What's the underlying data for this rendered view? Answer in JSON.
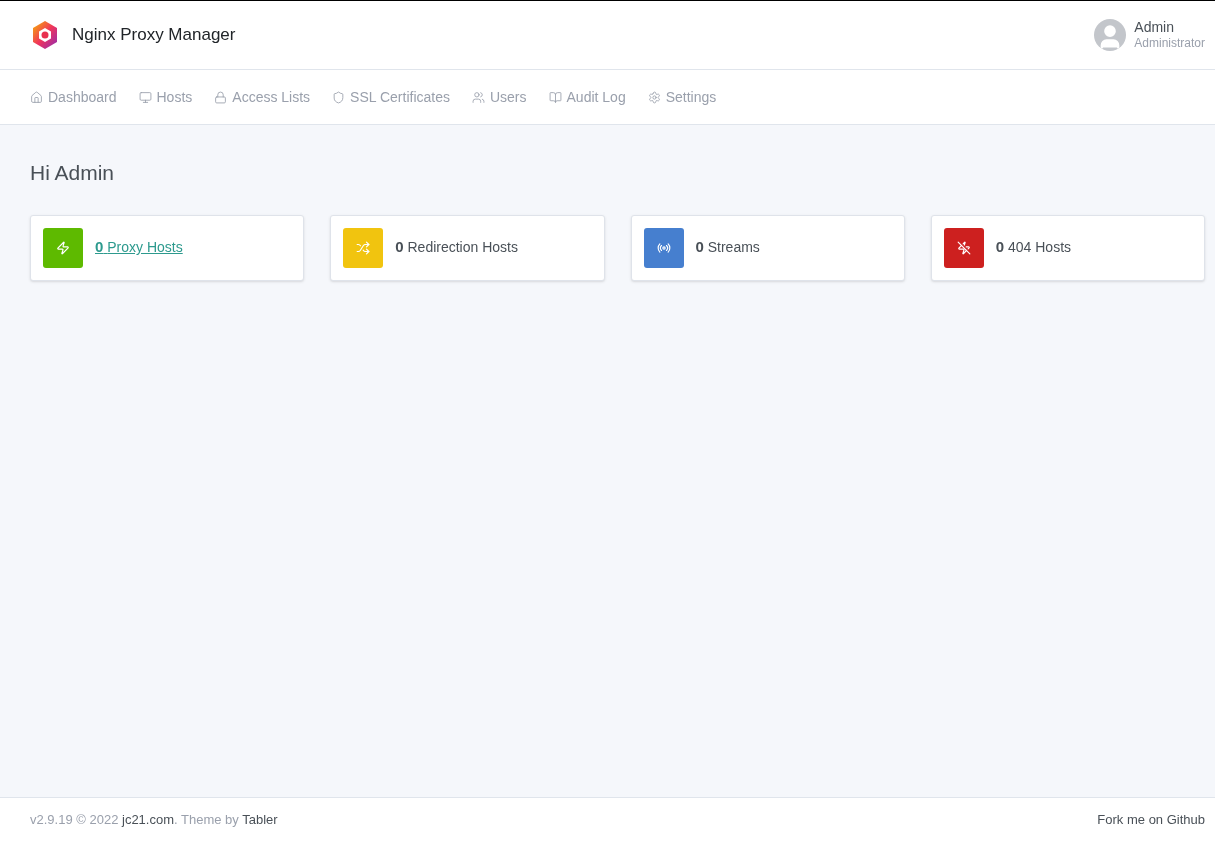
{
  "header": {
    "title": "Nginx Proxy Manager",
    "user": {
      "name": "Admin",
      "role": "Administrator"
    }
  },
  "nav": [
    {
      "kind": "home",
      "label": "Dashboard"
    },
    {
      "kind": "monitor",
      "label": "Hosts"
    },
    {
      "kind": "lock",
      "label": "Access Lists"
    },
    {
      "kind": "shield",
      "label": "SSL Certificates"
    },
    {
      "kind": "users",
      "label": "Users"
    },
    {
      "kind": "book",
      "label": "Audit Log"
    },
    {
      "kind": "settings",
      "label": "Settings"
    }
  ],
  "greeting": "Hi Admin",
  "cards": [
    {
      "kind": "zap",
      "color": "#5eba00",
      "count": "0",
      "label": "Proxy Hosts",
      "hovered": true
    },
    {
      "kind": "shuffle",
      "color": "#f1c40f",
      "count": "0",
      "label": "Redirection Hosts",
      "hovered": false
    },
    {
      "kind": "radio",
      "color": "#467fcf",
      "count": "0",
      "label": "Streams",
      "hovered": false
    },
    {
      "kind": "zapoff",
      "color": "#cd201f",
      "count": "0",
      "label": "404 Hosts",
      "hovered": false
    }
  ],
  "footer": {
    "version": "v2.9.19 © 2022",
    "site_link": "jc21.com",
    "theme_text": ". Theme by",
    "theme_link": "Tabler",
    "github_link": "Fork me on Github"
  }
}
